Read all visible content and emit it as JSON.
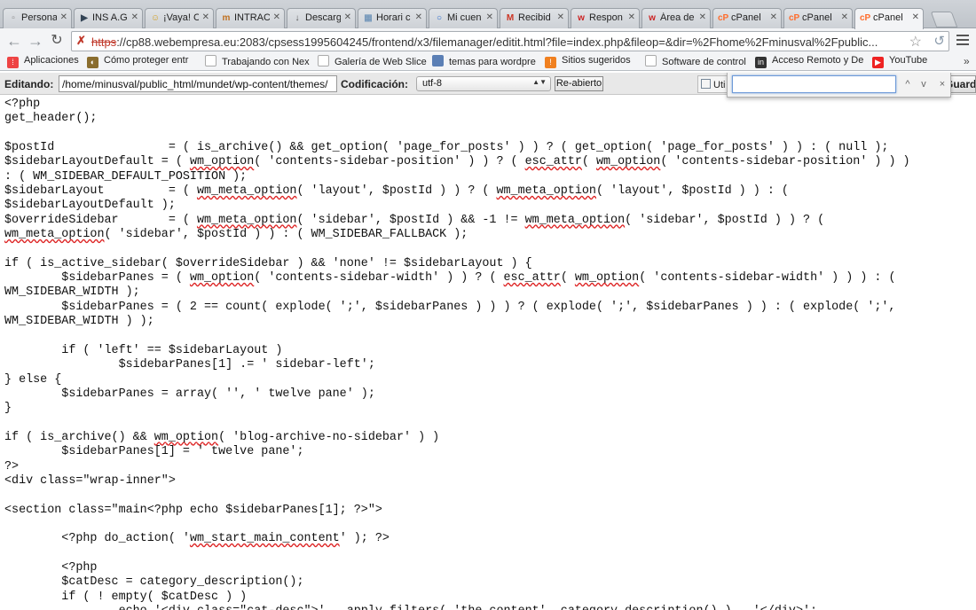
{
  "tabs": [
    {
      "label": "Persona",
      "icon": "page-icon",
      "color": "#888888"
    },
    {
      "label": "INS A.G",
      "icon": "ins-icon",
      "color": "#334455"
    },
    {
      "label": "¡Vaya! C",
      "icon": "smiley-icon",
      "color": "#d4a020"
    },
    {
      "label": "INTRAC",
      "icon": "intranet-icon",
      "color": "#c07020"
    },
    {
      "label": "Descarg",
      "icon": "download-icon",
      "color": "#555555"
    },
    {
      "label": "Horari c",
      "icon": "calendar-icon",
      "color": "#7799bb"
    },
    {
      "label": "Mi cuen",
      "icon": "account-icon",
      "color": "#2266cc"
    },
    {
      "label": "Recibid",
      "icon": "gmail-icon",
      "color": "#cc3322"
    },
    {
      "label": "Respon",
      "icon": "w-icon",
      "color": "#cc2222"
    },
    {
      "label": "Área de",
      "icon": "w-icon",
      "color": "#cc2222"
    },
    {
      "label": "cPanel",
      "icon": "cpanel-icon",
      "color": "#ff6c2c"
    },
    {
      "label": "cPanel",
      "icon": "cpanel-icon",
      "color": "#ff6c2c"
    },
    {
      "label": "cPanel",
      "icon": "cpanel-icon",
      "color": "#ff6c2c"
    }
  ],
  "address": {
    "scheme": "https",
    "rest": "://cp88.webempresa.eu:2083/cpsess1995604245/frontend/x3/filemanager/editit.html?file=index.php&fileop=&dir=%2Fhome%2Fminusval%2Fpublic..."
  },
  "bookmarks": [
    {
      "label": "Aplicaciones",
      "icon": "apps-icon",
      "color": "#e44"
    },
    {
      "label": "Cómo proteger entr",
      "icon": "protect-icon",
      "color": "#8a6d2e"
    },
    {
      "label": "Trabajando con Nex",
      "icon": "page-icon",
      "color": "#999"
    },
    {
      "label": "Galería de Web Slice",
      "icon": "page-icon",
      "color": "#999"
    },
    {
      "label": "temas para wordpre",
      "icon": "folder-icon",
      "color": "#5b7fb5"
    },
    {
      "label": "Sitios sugeridos",
      "icon": "sites-icon",
      "color": "#f08020"
    },
    {
      "label": "Software de control",
      "icon": "page-icon",
      "color": "#999"
    },
    {
      "label": "Acceso Remoto y De",
      "icon": "linkedin-icon",
      "color": "#333"
    },
    {
      "label": "YouTube",
      "icon": "youtube-icon",
      "color": "#e22"
    }
  ],
  "editor": {
    "editing_label": "Editando:",
    "path": "/home/minusval/public_html/mundet/wp-content/themes/",
    "encoding_label": "Codificación:",
    "encoding_value": "utf-8",
    "reopen_button": "Re-abierto",
    "side_tab": "Uti",
    "save_button": "Guardar cambios"
  },
  "find": {
    "value": "",
    "prev": "^",
    "next": "v",
    "close": "×"
  },
  "code": [
    [
      [
        "t",
        "<?php"
      ]
    ],
    [
      [
        "t",
        "get_header();"
      ]
    ],
    [
      [
        "t",
        ""
      ]
    ],
    [
      [
        "t",
        "$postId                = ( is_archive() && get_option( 'page_for_posts' ) ) ? ( get_option( 'page_for_posts' ) ) : ( null );"
      ]
    ],
    [
      [
        "t",
        "$sidebarLayoutDefault = ( "
      ],
      [
        "s",
        "wm_option"
      ],
      [
        "t",
        "( 'contents-sidebar-position' ) ) ? ( "
      ],
      [
        "s",
        "esc_attr"
      ],
      [
        "t",
        "( "
      ],
      [
        "s",
        "wm_option"
      ],
      [
        "t",
        "( 'contents-sidebar-position' ) ) )"
      ]
    ],
    [
      [
        "t",
        ": ( WM_SIDEBAR_DEFAULT_POSITION );"
      ]
    ],
    [
      [
        "t",
        "$sidebarLayout         = ( "
      ],
      [
        "s",
        "wm_meta_option"
      ],
      [
        "t",
        "( 'layout', $postId ) ) ? ( "
      ],
      [
        "s",
        "wm_meta_option"
      ],
      [
        "t",
        "( 'layout', $postId ) ) : ("
      ]
    ],
    [
      [
        "t",
        "$sidebarLayoutDefault );"
      ]
    ],
    [
      [
        "t",
        "$overrideSidebar       = ( "
      ],
      [
        "s",
        "wm_meta_option"
      ],
      [
        "t",
        "( 'sidebar', $postId ) && -1 != "
      ],
      [
        "s",
        "wm_meta_option"
      ],
      [
        "t",
        "( 'sidebar', $postId ) ) ? ("
      ]
    ],
    [
      [
        "s",
        "wm_meta_option"
      ],
      [
        "t",
        "( 'sidebar', $postId ) ) : ( WM_SIDEBAR_FALLBACK );"
      ]
    ],
    [
      [
        "t",
        ""
      ]
    ],
    [
      [
        "t",
        "if ( is_active_sidebar( $overrideSidebar ) && 'none' != $sidebarLayout ) {"
      ]
    ],
    [
      [
        "t",
        "        $sidebarPanes = ( "
      ],
      [
        "s",
        "wm_option"
      ],
      [
        "t",
        "( 'contents-sidebar-width' ) ) ? ( "
      ],
      [
        "s",
        "esc_attr"
      ],
      [
        "t",
        "( "
      ],
      [
        "s",
        "wm_option"
      ],
      [
        "t",
        "( 'contents-sidebar-width' ) ) ) : ("
      ]
    ],
    [
      [
        "t",
        "WM_SIDEBAR_WIDTH );"
      ]
    ],
    [
      [
        "t",
        "        $sidebarPanes = ( 2 == count( explode( ';', $sidebarPanes ) ) ) ? ( explode( ';', $sidebarPanes ) ) : ( explode( ';',"
      ]
    ],
    [
      [
        "t",
        "WM_SIDEBAR_WIDTH ) );"
      ]
    ],
    [
      [
        "t",
        ""
      ]
    ],
    [
      [
        "t",
        "        if ( 'left' == $sidebarLayout )"
      ]
    ],
    [
      [
        "t",
        "                $sidebarPanes[1] .= ' sidebar-left';"
      ]
    ],
    [
      [
        "t",
        "} else {"
      ]
    ],
    [
      [
        "t",
        "        $sidebarPanes = array( '', ' twelve pane' );"
      ]
    ],
    [
      [
        "t",
        "}"
      ]
    ],
    [
      [
        "t",
        ""
      ]
    ],
    [
      [
        "t",
        "if ( is_archive() && "
      ],
      [
        "s",
        "wm_option"
      ],
      [
        "t",
        "( 'blog-archive-no-sidebar' ) )"
      ]
    ],
    [
      [
        "t",
        "        $sidebarPanes[1] = ' twelve pane';"
      ]
    ],
    [
      [
        "t",
        "?>"
      ]
    ],
    [
      [
        "t",
        "<div class=\"wrap-inner\">"
      ]
    ],
    [
      [
        "t",
        ""
      ]
    ],
    [
      [
        "t",
        "<section class=\"main<?php echo $sidebarPanes[1]; ?>\">"
      ]
    ],
    [
      [
        "t",
        ""
      ]
    ],
    [
      [
        "t",
        "        <?php do_action( '"
      ],
      [
        "s",
        "wm_start_main_content"
      ],
      [
        "t",
        "' ); ?>"
      ]
    ],
    [
      [
        "t",
        ""
      ]
    ],
    [
      [
        "t",
        "        <?php"
      ]
    ],
    [
      [
        "t",
        "        $catDesc = category_description();"
      ]
    ],
    [
      [
        "t",
        "        if ( ! empty( $catDesc ) )"
      ]
    ],
    [
      [
        "t",
        "                echo '<div class=\"cat-desc\">' . apply_filters( 'the_content', category_description() ) . '</div>';"
      ]
    ]
  ]
}
